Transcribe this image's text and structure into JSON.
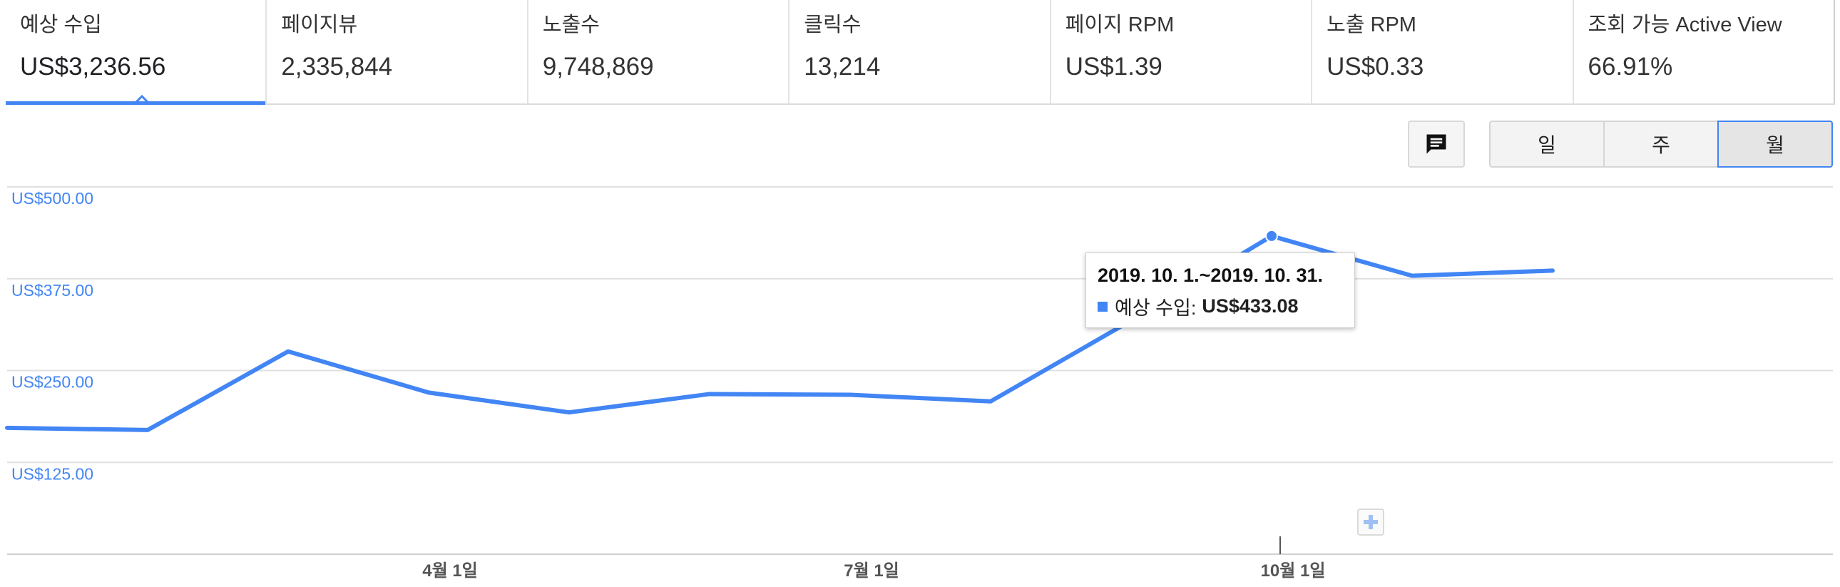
{
  "metrics": [
    {
      "label": "예상 수입",
      "value": "US$3,236.56"
    },
    {
      "label": "페이지뷰",
      "value": "2,335,844"
    },
    {
      "label": "노출수",
      "value": "9,748,869"
    },
    {
      "label": "클릭수",
      "value": "13,214"
    },
    {
      "label": "페이지 RPM",
      "value": "US$1.39"
    },
    {
      "label": "노출 RPM",
      "value": "US$0.33"
    },
    {
      "label": "조회 가능 Active View",
      "value": "66.91%"
    }
  ],
  "active_metric": "예상 수입",
  "toolbar": {
    "annotation_icon": "comment-icon",
    "granularity": [
      "일",
      "주",
      "월"
    ],
    "selected_granularity": "월"
  },
  "tooltip": {
    "date_range": "2019. 10. 1.~2019. 10. 31.",
    "series_label": "예상 수입:",
    "value": "US$433.08"
  },
  "add_annotation_icon": "plus-icon",
  "colors": {
    "series": "#4285f4",
    "grid": "#e0e0e0",
    "axis_label": "#4285f4"
  },
  "chart_data": {
    "type": "line",
    "x": [
      "2019-01",
      "2019-02",
      "2019-03",
      "2019-04",
      "2019-05",
      "2019-06",
      "2019-07",
      "2019-08",
      "2019-09",
      "2019-10",
      "2019-11",
      "2019-12"
    ],
    "series": [
      {
        "values": [
          172,
          169,
          276,
          220,
          193,
          218,
          217,
          208,
          318,
          433.08,
          379,
          386
        ]
      }
    ],
    "y_ticks": [
      {
        "value": 125,
        "label": "US$125.00"
      },
      {
        "value": 250,
        "label": "US$250.00"
      },
      {
        "value": 375,
        "label": "US$375.00"
      },
      {
        "value": 500,
        "label": "US$500.00"
      }
    ],
    "x_ticks": [
      {
        "index": 3,
        "label": "4월 1일"
      },
      {
        "index": 6,
        "label": "7월 1일"
      },
      {
        "index": 9,
        "label": "10월 1일"
      }
    ],
    "ylim": [
      0,
      500
    ],
    "highlight_index": 9,
    "grid": true
  }
}
